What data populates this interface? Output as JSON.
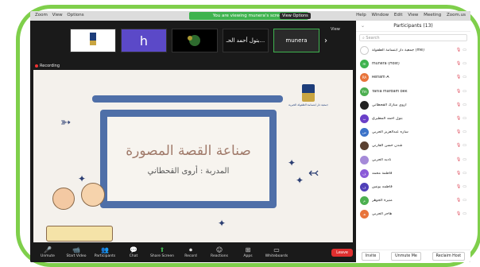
{
  "menubar": {
    "left_items": [
      "Zoom",
      "View",
      "Options"
    ],
    "viewing_text": "You are viewing munera's screen",
    "view_options": "View Options",
    "right_items": [
      "Help",
      "Window",
      "Edit",
      "View",
      "Meeting",
      "Zoom.us"
    ]
  },
  "thumbs": {
    "h_letter": "h",
    "name_label": "بتول أحمد الحـ...",
    "active_label": "munera"
  },
  "view_button": "View",
  "recording_label": "Recording",
  "slide": {
    "title": "صناعة القصة المصورة",
    "subtitle": "المدربة : أروى القحطاني",
    "logo_text": "جمعية دار ابتسامة الطفولة الخيرية"
  },
  "toolbar": {
    "items": [
      {
        "icon": "🎤",
        "label": "Unmute"
      },
      {
        "icon": "📹",
        "label": "Start Video"
      },
      {
        "icon": "👥",
        "label": "Participants"
      },
      {
        "icon": "💬",
        "label": "Chat"
      },
      {
        "icon": "⬆",
        "label": "Share Screen"
      },
      {
        "icon": "⏺",
        "label": "Record"
      },
      {
        "icon": "☺",
        "label": "Reactions"
      },
      {
        "icon": "⊞",
        "label": "Apps"
      },
      {
        "icon": "▭",
        "label": "Whiteboards"
      }
    ],
    "leave": "Leave"
  },
  "participants": {
    "title": "Participants (13)",
    "search_placeholder": "Search",
    "list": [
      {
        "name": "جمعية دار ابتسامة الطفولة (me)",
        "initials": "",
        "color": "#ffffff"
      },
      {
        "name": "munera (Host)",
        "initials": "m",
        "color": "#3fb34f"
      },
      {
        "name": "Reham A",
        "initials": "RA",
        "color": "#e8743b"
      },
      {
        "name": "Yahia mardam bek",
        "initials": "Ym",
        "color": "#4caf50"
      },
      {
        "name": "أروى مبارك القحطاني",
        "initials": "",
        "color": "#222222"
      },
      {
        "name": "بتول أحمد المطيري",
        "initials": "ب",
        "color": "#6a3fc8"
      },
      {
        "name": "ساره عبدالعزيز الحربي",
        "initials": "س",
        "color": "#3b72c8"
      },
      {
        "name": "شدن حسن القارني",
        "initials": "",
        "color": "#5a4030"
      },
      {
        "name": "ناديه الحربي",
        "initials": "",
        "color": "#a58ad8"
      },
      {
        "name": "فاطمة محمد",
        "initials": "ف",
        "color": "#8a5ad8"
      },
      {
        "name": "فاطمه يونس",
        "initials": "ف",
        "color": "#4f3fb8"
      },
      {
        "name": "منيرة الجوهر",
        "initials": "م",
        "color": "#4caf50"
      },
      {
        "name": "هاجر الحربي",
        "initials": "هـ",
        "color": "#e8743b"
      }
    ],
    "footer": {
      "invite": "Invite",
      "unmute_me": "Unmute Me",
      "reclaim_host": "Reclaim Host"
    }
  }
}
